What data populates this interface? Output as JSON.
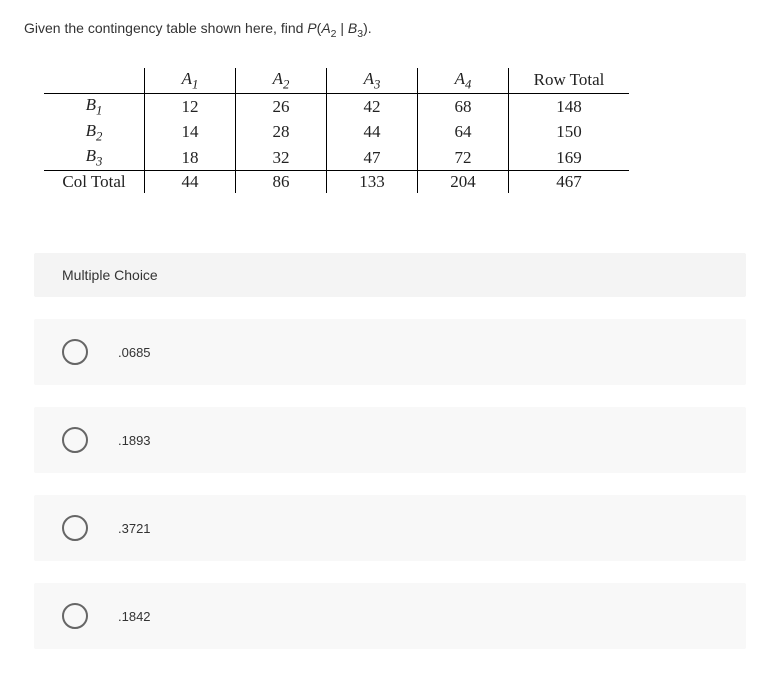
{
  "question": {
    "prefix": "Given the contingency table shown here, find ",
    "expr_P": "P",
    "expr_open": "(",
    "expr_A": "A",
    "expr_A_sub": "2",
    "expr_given": " | ",
    "expr_B": "B",
    "expr_B_sub": "3",
    "expr_close": ").",
    "headers": {
      "blank": "",
      "a1": "A",
      "a1_sub": "1",
      "a2": "A",
      "a2_sub": "2",
      "a3": "A",
      "a3_sub": "3",
      "a4": "A",
      "a4_sub": "4",
      "row_total": "Row Total"
    },
    "rows": [
      {
        "label": "B",
        "label_sub": "1",
        "c": [
          "12",
          "26",
          "42",
          "68",
          "148"
        ]
      },
      {
        "label": "B",
        "label_sub": "2",
        "c": [
          "14",
          "28",
          "44",
          "64",
          "150"
        ]
      },
      {
        "label": "B",
        "label_sub": "3",
        "c": [
          "18",
          "32",
          "47",
          "72",
          "169"
        ]
      }
    ],
    "col_total": {
      "label": "Col Total",
      "c": [
        "44",
        "86",
        "133",
        "204",
        "467"
      ]
    }
  },
  "mc_heading": "Multiple Choice",
  "options": [
    {
      "label": ".0685"
    },
    {
      "label": ".1893"
    },
    {
      "label": ".3721"
    },
    {
      "label": ".1842"
    }
  ]
}
